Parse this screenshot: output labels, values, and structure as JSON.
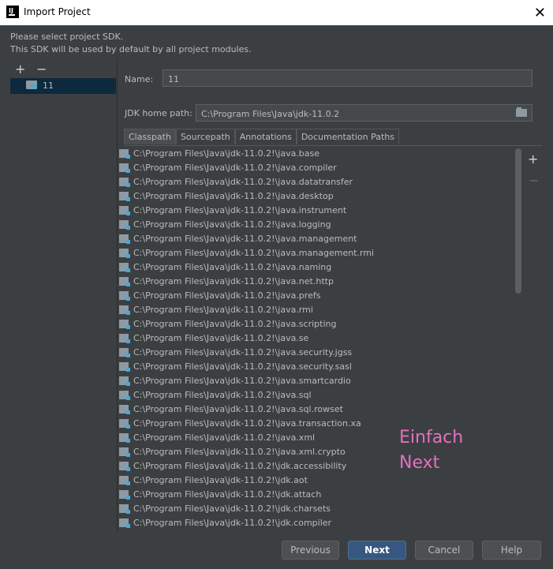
{
  "window": {
    "title": "Import Project",
    "close_glyph": "✕"
  },
  "header": {
    "line1": "Please select project SDK.",
    "line2": "This SDK will be used by default by all project modules."
  },
  "sdk_list": {
    "add_glyph": "+",
    "remove_glyph": "−",
    "items": [
      {
        "label": "11",
        "icon": "folder-sdk-icon"
      }
    ]
  },
  "form": {
    "name_label": "Name:",
    "name_value": "11",
    "home_label": "JDK home path:",
    "home_value": "C:\\Program Files\\Java\\jdk-11.0.2"
  },
  "tabs": [
    "Classpath",
    "Sourcepath",
    "Annotations",
    "Documentation Paths"
  ],
  "classpath": [
    "C:\\Program Files\\Java\\jdk-11.0.2!\\java.base",
    "C:\\Program Files\\Java\\jdk-11.0.2!\\java.compiler",
    "C:\\Program Files\\Java\\jdk-11.0.2!\\java.datatransfer",
    "C:\\Program Files\\Java\\jdk-11.0.2!\\java.desktop",
    "C:\\Program Files\\Java\\jdk-11.0.2!\\java.instrument",
    "C:\\Program Files\\Java\\jdk-11.0.2!\\java.logging",
    "C:\\Program Files\\Java\\jdk-11.0.2!\\java.management",
    "C:\\Program Files\\Java\\jdk-11.0.2!\\java.management.rmi",
    "C:\\Program Files\\Java\\jdk-11.0.2!\\java.naming",
    "C:\\Program Files\\Java\\jdk-11.0.2!\\java.net.http",
    "C:\\Program Files\\Java\\jdk-11.0.2!\\java.prefs",
    "C:\\Program Files\\Java\\jdk-11.0.2!\\java.rmi",
    "C:\\Program Files\\Java\\jdk-11.0.2!\\java.scripting",
    "C:\\Program Files\\Java\\jdk-11.0.2!\\java.se",
    "C:\\Program Files\\Java\\jdk-11.0.2!\\java.security.jgss",
    "C:\\Program Files\\Java\\jdk-11.0.2!\\java.security.sasl",
    "C:\\Program Files\\Java\\jdk-11.0.2!\\java.smartcardio",
    "C:\\Program Files\\Java\\jdk-11.0.2!\\java.sql",
    "C:\\Program Files\\Java\\jdk-11.0.2!\\java.sql.rowset",
    "C:\\Program Files\\Java\\jdk-11.0.2!\\java.transaction.xa",
    "C:\\Program Files\\Java\\jdk-11.0.2!\\java.xml",
    "C:\\Program Files\\Java\\jdk-11.0.2!\\java.xml.crypto",
    "C:\\Program Files\\Java\\jdk-11.0.2!\\jdk.accessibility",
    "C:\\Program Files\\Java\\jdk-11.0.2!\\jdk.aot",
    "C:\\Program Files\\Java\\jdk-11.0.2!\\jdk.attach",
    "C:\\Program Files\\Java\\jdk-11.0.2!\\jdk.charsets",
    "C:\\Program Files\\Java\\jdk-11.0.2!\\jdk.compiler"
  ],
  "side_toolbar": {
    "add_glyph": "+",
    "remove_glyph": "−"
  },
  "annotation": {
    "line1": "Einfach",
    "line2": "Next",
    "color": "#e46fc2"
  },
  "buttons": {
    "previous": "Previous",
    "next": "Next",
    "cancel": "Cancel",
    "help": "Help"
  },
  "colors": {
    "background": "#3c3f41",
    "selection": "#0d293e",
    "primary_button": "#365880"
  }
}
